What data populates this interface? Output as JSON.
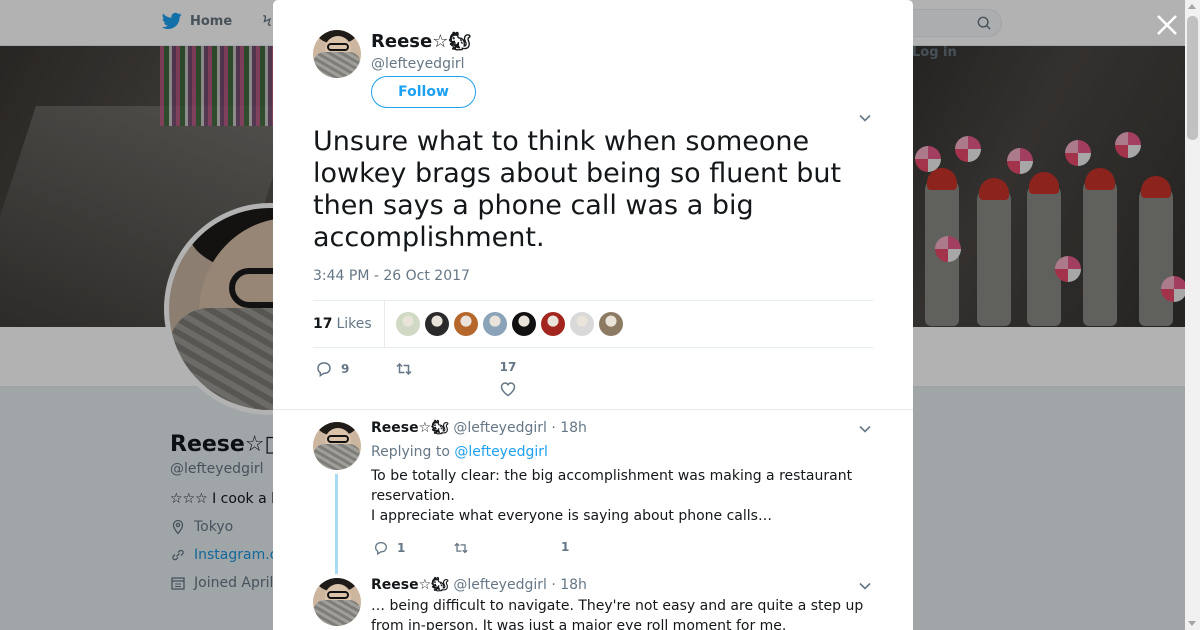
{
  "background_page": {
    "nav": {
      "home_label": "Home",
      "login_label": "Log in",
      "moments_partial": "Ϟ"
    },
    "profile": {
      "name": "Reese☆▯",
      "handle": "@lefteyedgirl",
      "bio": "☆☆☆ I cook a l",
      "location": "Tokyo",
      "link": "Instagram.c",
      "joined": "Joined April"
    }
  },
  "tweet": {
    "author_name": "Reese☆🐿",
    "author_handle": "@lefteyedgirl",
    "follow_label": "Follow",
    "text": "Unsure what to think when someone lowkey brags about being so fluent but then says a phone call was a big accomplishment.",
    "timestamp": "3:44 PM - 26 Oct 2017",
    "likes_count": "17",
    "likes_label": "Likes",
    "replies": "9",
    "retweets": "",
    "likes_action": "17"
  },
  "likers": [
    {
      "name": "liker-1",
      "color": "#cfd9c4"
    },
    {
      "name": "liker-2",
      "color": "#2a2a2a"
    },
    {
      "name": "liker-3",
      "color": "#b5672c"
    },
    {
      "name": "liker-4",
      "color": "#8aa3b8"
    },
    {
      "name": "liker-5",
      "color": "#111111"
    },
    {
      "name": "liker-6",
      "color": "#a3261e"
    },
    {
      "name": "liker-7",
      "color": "#d9d9d9"
    },
    {
      "name": "liker-8",
      "color": "#8c7a62"
    }
  ],
  "replies": [
    {
      "author_name": "Reese☆🐿",
      "author_handle": "@lefteyedgirl",
      "time": "· 18h",
      "replying_prefix": "Replying to",
      "replying_to": "@lefteyedgirl",
      "text_line1": "To be totally clear: the big accomplishment was making a restaurant reservation.",
      "text_line2": "I appreciate what everyone is saying about phone calls…",
      "replies": "1",
      "retweets": "",
      "likes": "1"
    },
    {
      "author_name": "Reese☆🐿",
      "author_handle": "@lefteyedgirl",
      "time": "· 18h",
      "text": "… being difficult to navigate. They're not easy and are quite a step up from in-person. It was just a major eye roll moment for me."
    }
  ],
  "colors": {
    "accent": "#1da1f2",
    "thread_line": "#a8dcf4",
    "muted": "#657786"
  }
}
